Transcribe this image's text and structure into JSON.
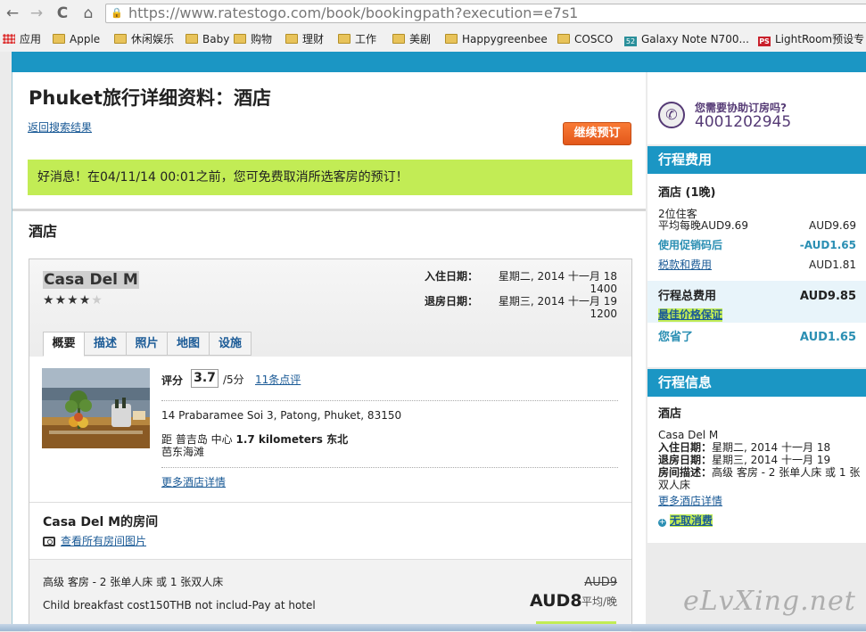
{
  "browser": {
    "url": "https://www.ratestogo.com/book/bookingpath?execution=e7s1",
    "nav": {
      "back": "←",
      "forward": "→",
      "reload": "C",
      "home": "⌂"
    },
    "bookmarks": [
      {
        "label": "应用",
        "icon": "apps-icon"
      },
      {
        "label": "Apple",
        "icon": "folder-icon"
      },
      {
        "label": "休闲娱乐",
        "icon": "folder-icon"
      },
      {
        "label": "Baby",
        "icon": "folder-icon"
      },
      {
        "label": "购物",
        "icon": "folder-icon"
      },
      {
        "label": "理财",
        "icon": "folder-icon"
      },
      {
        "label": "工作",
        "icon": "folder-icon"
      },
      {
        "label": "美剧",
        "icon": "folder-icon"
      },
      {
        "label": "Happygreenbee",
        "icon": "folder-icon"
      },
      {
        "label": "COSCO",
        "icon": "folder-icon"
      },
      {
        "label": "Galaxy Note N700...",
        "icon": "site-52-icon",
        "badge": "52"
      },
      {
        "label": "LightRoom预设专",
        "icon": "site-ps-icon",
        "badge": "PS"
      }
    ]
  },
  "page": {
    "title": "Phuket旅行详细资料：酒店",
    "back_link": "返回搜索结果",
    "continue_button": "继续预订",
    "good_news": "好消息！在04/11/14 00:01之前，您可免费取消所选客房的预订！",
    "hotel_heading": "酒店"
  },
  "hotel": {
    "name": "Casa Del M",
    "rating_stars": 4,
    "max_stars": 5,
    "checkin_label": "入住日期：",
    "checkin_date": "星期二, 2014 十一月 18",
    "checkin_time": "1400",
    "checkout_label": "退房日期：",
    "checkout_date": "星期三, 2014 十一月 19",
    "checkout_time": "1200",
    "tabs": [
      "概要",
      "描述",
      "照片",
      "地图",
      "设施"
    ],
    "score_label": "评分",
    "score": "3.7",
    "score_max": "/5分",
    "reviews_link": "11条点评",
    "address": "14 Prabaramee Soi 3, Patong, Phuket, 83150",
    "distance_prefix": "距 普吉岛 中心",
    "distance_value": "1.7 kilometers 东北",
    "area": "芭东海滩",
    "more_details": "更多酒店详情"
  },
  "rooms": {
    "title": "Casa Del M的房间",
    "photos_link": "查看所有房间图片",
    "room_name": "高级 客房 - 2 张单人床 或 1 张双人床",
    "room_note": "Child breakfast cost150THB not includ-Pay at hotel",
    "old_price": "AUD9",
    "price": "AUD8",
    "per_night": "平均/晚"
  },
  "sidebar": {
    "help_question": "您需要协助订房吗?",
    "help_phone": "4001202945",
    "cost": {
      "title": "行程费用",
      "hotel_nights": "酒店 (1晚)",
      "guests": "2位住客",
      "avg_label": "平均每晚AUD9.69",
      "avg_value": "AUD9.69",
      "promo_label": "使用促销码后",
      "promo_value": "-AUD1.65",
      "tax_label": "税款和费用",
      "tax_value": "AUD1.81",
      "total_label": "行程总费用",
      "total_value": "AUD9.85",
      "best_price": "最佳价格保证",
      "saved_label": "您省了",
      "saved_value": "AUD1.65"
    },
    "trip": {
      "title": "行程信息",
      "hotel_label": "酒店",
      "hotel_name": "Casa Del M",
      "checkin_label": "入住日期：",
      "checkin_value": "星期二, 2014 十一月 18",
      "checkout_label": "退房日期：",
      "checkout_value": "星期三, 2014 十一月 19",
      "room_label": "房间描述：",
      "room_value_1": "高级 客房 - 2 张单人床 或 1 张",
      "room_value_2": "双人床",
      "more_details": "更多酒店详情",
      "no_fee": "无取消费"
    }
  },
  "watermark": "eLvXing.net",
  "colors": {
    "brand_blue": "#1b96c4",
    "highlight_green": "#c2ec55",
    "button_orange": "#f06a28",
    "link_blue": "#1a5a96"
  }
}
